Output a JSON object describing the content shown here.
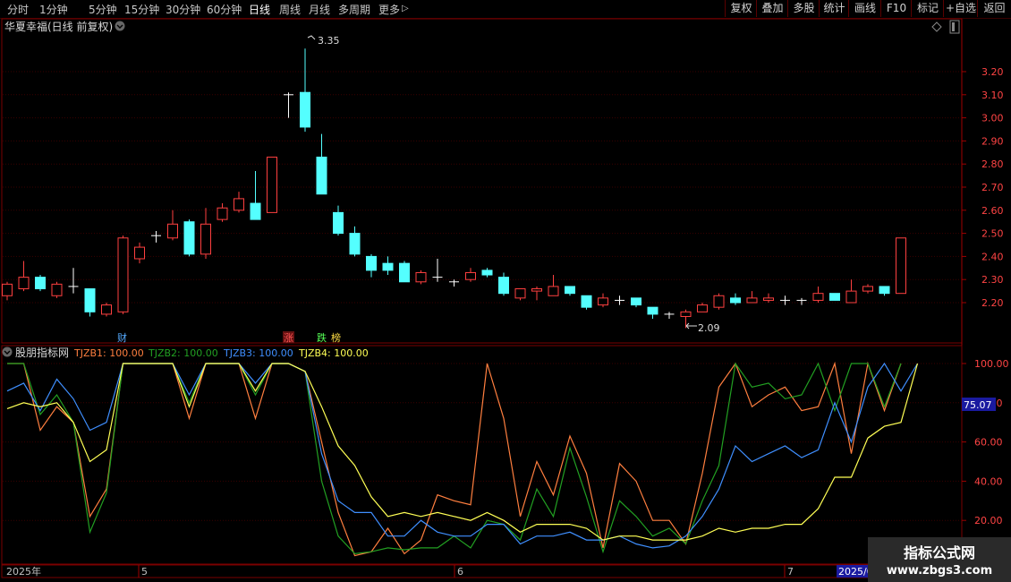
{
  "toolbar": {
    "periods": [
      "分时",
      "1分钟",
      "5分钟",
      "15分钟",
      "30分钟",
      "60分钟",
      "日线",
      "周线",
      "月线",
      "多周期",
      "更多"
    ],
    "active_period": "日线",
    "more_arrow": "▷",
    "tools": [
      "复权",
      "叠加",
      "多股",
      "统计",
      "画线",
      "F10",
      "标记",
      "+自选",
      "返回"
    ]
  },
  "header": {
    "title": "华夏幸福(日线 前复权)"
  },
  "indicator": {
    "name": "股朋指标网",
    "lines": [
      {
        "label": "TJZB1: 100.00",
        "color": "#ff7f3f"
      },
      {
        "label": "TJZB2: 100.00",
        "color": "#22a022"
      },
      {
        "label": "TJZB3: 100.00",
        "color": "#3f8fff"
      },
      {
        "label": "TJZB4: 100.00",
        "color": "#ffff55"
      }
    ]
  },
  "events": [
    {
      "label": "财",
      "color": "#55aaff"
    },
    {
      "label": "涨",
      "color": "#ff5555"
    },
    {
      "label": "跌",
      "color": "#55ff55"
    },
    {
      "label": "榜",
      "color": "#ffdd44"
    }
  ],
  "cursor": {
    "value": "75.07"
  },
  "dates": [
    "2025年",
    "5",
    "6",
    "7",
    "2025/0"
  ],
  "watermark": {
    "line1": "指标公式网",
    "line2": "www.zbgs3.com"
  },
  "chart_data": [
    {
      "type": "candlestick",
      "title": "华夏幸福(日线 前复权)",
      "y_ticks": [
        2.2,
        2.3,
        2.4,
        2.5,
        2.6,
        2.7,
        2.8,
        2.9,
        3.0,
        3.1,
        3.2
      ],
      "ylim": [
        2.09,
        3.35
      ],
      "max_label": "3.35",
      "min_label": "2.09",
      "candles": [
        [
          2.23,
          2.28,
          2.29,
          2.21
        ],
        [
          2.26,
          2.31,
          2.38,
          2.25
        ],
        [
          2.31,
          2.26,
          2.32,
          2.25
        ],
        [
          2.23,
          2.28,
          2.29,
          2.22
        ],
        [
          2.27,
          2.27,
          2.35,
          2.24
        ],
        [
          2.26,
          2.16,
          2.26,
          2.14
        ],
        [
          2.15,
          2.19,
          2.2,
          2.14
        ],
        [
          2.16,
          2.48,
          2.49,
          2.15
        ],
        [
          2.39,
          2.44,
          2.46,
          2.37
        ],
        [
          2.49,
          2.49,
          2.51,
          2.46
        ],
        [
          2.48,
          2.54,
          2.6,
          2.47
        ],
        [
          2.55,
          2.41,
          2.56,
          2.4
        ],
        [
          2.41,
          2.54,
          2.61,
          2.39
        ],
        [
          2.56,
          2.61,
          2.63,
          2.55
        ],
        [
          2.6,
          2.65,
          2.68,
          2.59
        ],
        [
          2.63,
          2.56,
          2.77,
          2.56
        ],
        [
          2.59,
          2.83,
          2.83,
          2.59
        ],
        [
          3.1,
          3.1,
          3.11,
          3.0
        ],
        [
          3.11,
          2.96,
          3.3,
          2.94
        ],
        [
          2.83,
          2.67,
          2.93,
          2.67
        ],
        [
          2.59,
          2.5,
          2.62,
          2.49
        ],
        [
          2.5,
          2.41,
          2.53,
          2.4
        ],
        [
          2.4,
          2.34,
          2.41,
          2.31
        ],
        [
          2.37,
          2.34,
          2.4,
          2.32
        ],
        [
          2.37,
          2.29,
          2.38,
          2.29
        ],
        [
          2.29,
          2.33,
          2.34,
          2.28
        ],
        [
          2.31,
          2.31,
          2.39,
          2.29
        ],
        [
          2.29,
          2.29,
          2.3,
          2.27
        ],
        [
          2.3,
          2.33,
          2.35,
          2.29
        ],
        [
          2.34,
          2.32,
          2.35,
          2.31
        ],
        [
          2.31,
          2.24,
          2.33,
          2.23
        ],
        [
          2.22,
          2.26,
          2.26,
          2.21
        ],
        [
          2.25,
          2.26,
          2.27,
          2.21
        ],
        [
          2.23,
          2.27,
          2.32,
          2.23
        ],
        [
          2.27,
          2.24,
          2.27,
          2.23
        ],
        [
          2.23,
          2.18,
          2.23,
          2.17
        ],
        [
          2.19,
          2.22,
          2.24,
          2.18
        ],
        [
          2.21,
          2.21,
          2.23,
          2.19
        ],
        [
          2.22,
          2.19,
          2.22,
          2.18
        ],
        [
          2.18,
          2.15,
          2.18,
          2.13
        ],
        [
          2.15,
          2.15,
          2.16,
          2.13
        ],
        [
          2.14,
          2.16,
          2.17,
          2.09
        ],
        [
          2.16,
          2.19,
          2.2,
          2.16
        ],
        [
          2.18,
          2.23,
          2.24,
          2.17
        ],
        [
          2.22,
          2.2,
          2.24,
          2.19
        ],
        [
          2.2,
          2.22,
          2.25,
          2.2
        ],
        [
          2.21,
          2.22,
          2.24,
          2.2
        ],
        [
          2.21,
          2.21,
          2.23,
          2.19
        ],
        [
          2.21,
          2.21,
          2.22,
          2.19
        ],
        [
          2.21,
          2.24,
          2.27,
          2.2
        ],
        [
          2.24,
          2.21,
          2.24,
          2.21
        ],
        [
          2.2,
          2.25,
          2.3,
          2.2
        ],
        [
          2.25,
          2.27,
          2.28,
          2.24
        ],
        [
          2.27,
          2.24,
          2.27,
          2.23
        ],
        [
          2.24,
          2.48,
          2.48,
          2.24
        ]
      ]
    },
    {
      "type": "line",
      "title": "股朋指标网",
      "y_ticks": [
        20,
        40,
        60,
        80,
        100
      ],
      "ylim": [
        0,
        100
      ],
      "series": [
        {
          "name": "TJZB1",
          "color": "#ff7f3f",
          "values": [
            100,
            100,
            66,
            78,
            70,
            22,
            36,
            100,
            100,
            100,
            100,
            72,
            100,
            100,
            100,
            72,
            100,
            100,
            96,
            60,
            24,
            2,
            4,
            16,
            3,
            10,
            33,
            30,
            28,
            100,
            72,
            22,
            50,
            33,
            63,
            44,
            6,
            49,
            40,
            20,
            20,
            8,
            44,
            88,
            100,
            78,
            84,
            88,
            76,
            78,
            100,
            54,
            100,
            76,
            100
          ]
        },
        {
          "name": "TJZB2",
          "color": "#22a022",
          "values": [
            100,
            100,
            74,
            84,
            70,
            14,
            34,
            100,
            100,
            100,
            100,
            80,
            100,
            100,
            100,
            84,
            100,
            100,
            96,
            40,
            12,
            3,
            4,
            6,
            5,
            6,
            6,
            12,
            6,
            20,
            18,
            10,
            36,
            22,
            57,
            32,
            4,
            30,
            22,
            12,
            16,
            8,
            30,
            48,
            100,
            88,
            90,
            82,
            84,
            100,
            76,
            100,
            100,
            78,
            100
          ]
        },
        {
          "name": "TJZB3",
          "color": "#3f8fff",
          "values": [
            86,
            90,
            76,
            92,
            82,
            66,
            70,
            100,
            100,
            100,
            100,
            84,
            100,
            100,
            100,
            90,
            100,
            100,
            96,
            54,
            30,
            24,
            24,
            12,
            12,
            20,
            14,
            12,
            12,
            18,
            18,
            8,
            12,
            12,
            14,
            10,
            10,
            12,
            8,
            6,
            7,
            12,
            22,
            36,
            58,
            50,
            54,
            58,
            52,
            56,
            80,
            60,
            88,
            100,
            86,
            100
          ]
        },
        {
          "name": "TJZB4",
          "color": "#ffff55",
          "values": [
            77,
            80,
            78,
            80,
            70,
            50,
            56,
            100,
            100,
            100,
            100,
            78,
            100,
            100,
            100,
            86,
            100,
            100,
            96,
            78,
            58,
            48,
            32,
            22,
            24,
            22,
            24,
            22,
            20,
            24,
            20,
            14,
            18,
            18,
            18,
            16,
            10,
            12,
            12,
            10,
            10,
            10,
            12,
            16,
            14,
            16,
            16,
            18,
            18,
            26,
            42,
            42,
            62,
            68,
            70,
            100
          ]
        }
      ]
    }
  ]
}
